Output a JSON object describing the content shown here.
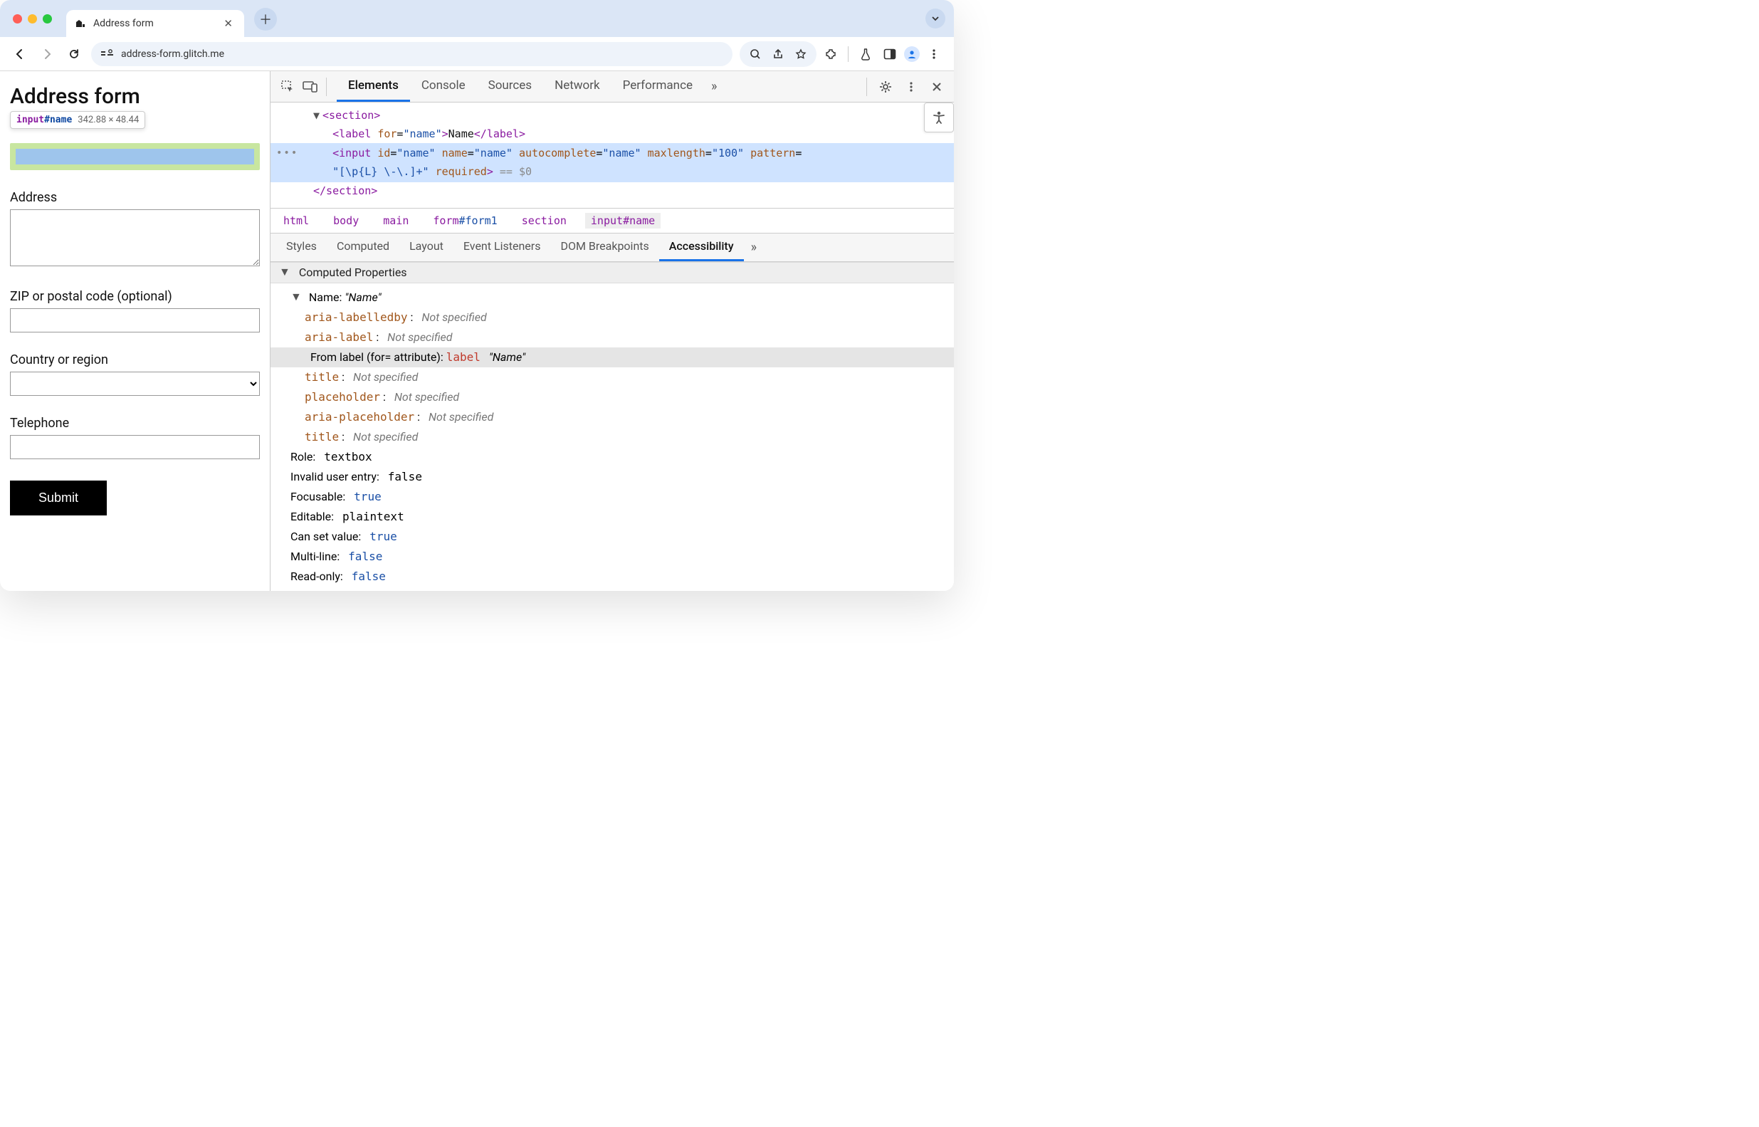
{
  "window": {
    "tab_title": "Address form",
    "url_display": "address-form.glitch.me"
  },
  "page": {
    "heading": "Address form",
    "tooltip": {
      "tag": "input",
      "id": "#name",
      "dims": "342.88 × 48.44"
    },
    "labels": {
      "address": "Address",
      "zip": "ZIP or postal code (optional)",
      "country": "Country or region",
      "tel": "Telephone"
    },
    "submit": "Submit"
  },
  "devtools": {
    "tabs": [
      "Elements",
      "Console",
      "Sources",
      "Network",
      "Performance"
    ],
    "active_tab": "Elements",
    "dom": {
      "section_open": "<section>",
      "label_open": "<label",
      "label_for_attr": "for",
      "label_for_val": "\"name\"",
      "label_close_g": ">",
      "label_text": "Name",
      "label_end": "</label>",
      "input_open": "<input",
      "input_attrs": [
        {
          "n": "id",
          "v": "\"name\""
        },
        {
          "n": "name",
          "v": "\"name\""
        },
        {
          "n": "autocomplete",
          "v": "\"name\""
        },
        {
          "n": "maxlength",
          "v": "\"100\""
        }
      ],
      "input_pattern_attr": "pattern",
      "input_pattern_val": "\"[\\p{L} \\-\\.]+\"",
      "input_required": "required",
      "input_tail": " == $0",
      "section_close": "</section>"
    },
    "crumbs": [
      "html",
      "body",
      "main",
      "form#form1",
      "section",
      "input#name"
    ],
    "subtabs": [
      "Styles",
      "Computed",
      "Layout",
      "Event Listeners",
      "DOM Breakpoints",
      "Accessibility"
    ],
    "active_subtab": "Accessibility",
    "acc": {
      "group": "Computed Properties",
      "name_label": "Name:",
      "name_value": "\"Name\"",
      "sources": [
        {
          "key": "aria-labelledby",
          "sep": ":",
          "val": "Not specified"
        },
        {
          "key": "aria-label",
          "sep": ":",
          "val": "Not specified"
        }
      ],
      "from_label_prefix": "From label (for= attribute): ",
      "from_label_tag": "label",
      "from_label_val": "\"Name\"",
      "sources2": [
        {
          "key": "title",
          "sep": ":",
          "val": "Not specified"
        },
        {
          "key": "placeholder",
          "sep": ":",
          "val": "Not specified"
        },
        {
          "key": "aria-placeholder",
          "sep": ":",
          "val": "Not specified"
        },
        {
          "key": "title",
          "sep": ":",
          "val": "Not specified"
        }
      ],
      "role_label": "Role:",
      "role_val": "textbox",
      "invalid_label": "Invalid user entry:",
      "invalid_val": "false",
      "focusable_label": "Focusable:",
      "focusable_val": "true",
      "editable_label": "Editable:",
      "editable_val": "plaintext",
      "canset_label": "Can set value:",
      "canset_val": "true",
      "multiline_label": "Multi-line:",
      "multiline_val": "false",
      "readonly_label": "Read-only:",
      "readonly_val": "false"
    }
  }
}
